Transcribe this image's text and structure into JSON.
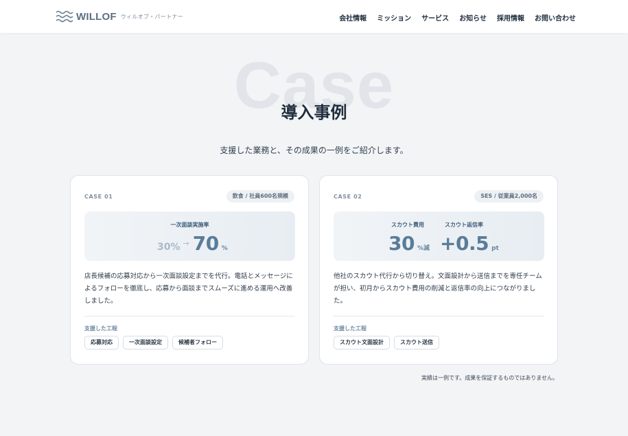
{
  "header": {
    "logo_text": "WILLOF",
    "logo_sub": "ウィルオブ・パートナー",
    "nav": [
      "会社情報",
      "ミッション",
      "サービス",
      "お知らせ",
      "採用情報",
      "お問い合わせ"
    ]
  },
  "hero": {
    "bg_word": "Case",
    "title": "導入事例",
    "subtitle": "支援した業務と、その成果の一例をご紹介します。"
  },
  "cases": [
    {
      "label": "CASE 01",
      "tag": "飲食 / 社員600名規模",
      "metric_label": "一次面談実施率",
      "before": "30%",
      "arrow": "→",
      "after": "70",
      "after_unit": "%",
      "desc": "店長候補の応募対応から一次面談設定までを代行。電話とメッセージによるフォローを徹底し、応募から面談までスムーズに進める運用へ改善しました。",
      "process_label": "支援した工程",
      "chips": [
        "応募対応",
        "一次面談設定",
        "候補者フォロー"
      ]
    },
    {
      "label": "CASE 02",
      "tag": "SES / 従業員2,000名",
      "metric_label_1": "スカウト費用",
      "metric_label_2": "スカウト返信率",
      "value_1": "30",
      "unit_1": "%減",
      "value_2": "+0.5",
      "unit_2": "pt",
      "desc": "他社のスカウト代行から切り替え。文面設計から送信までを専任チームが担い、初月からスカウト費用の削減と返信率の向上につながりました。",
      "process_label": "支援した工程",
      "chips": [
        "スカウト文面設計",
        "スカウト送信"
      ]
    }
  ],
  "note": "実績は一例です。成果を保証するものではありません。",
  "colors": {
    "accent": "#5a7c99",
    "page_bg": "#f2f4f6",
    "text": "#1f2d3d"
  },
  "icons": {
    "logo": "waves-icon",
    "arrow": "arrow-right-icon"
  }
}
